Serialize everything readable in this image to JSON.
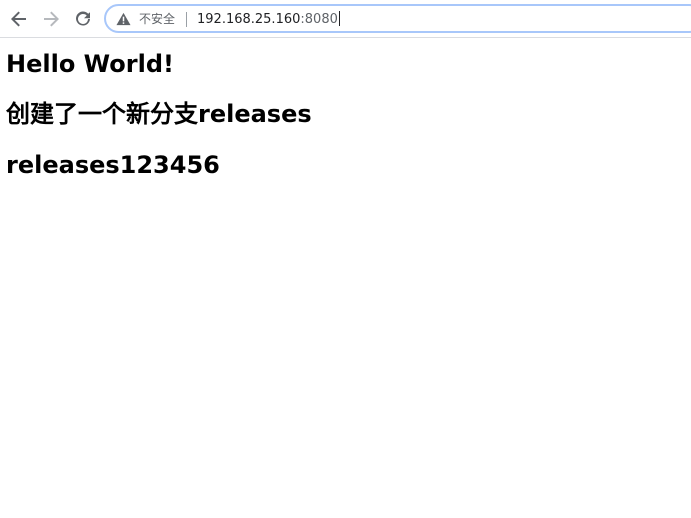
{
  "toolbar": {
    "security_label": "不安全",
    "url_host": "192.168.25.160",
    "url_port": ":8080"
  },
  "icons": {
    "back": "back-arrow-icon",
    "forward": "forward-arrow-icon",
    "reload": "reload-icon",
    "security": "warning-triangle-icon"
  },
  "colors": {
    "omnibox_border": "#a8c7fa",
    "text": "#000000",
    "muted": "#5f6368"
  },
  "page": {
    "headings": [
      "Hello World!",
      "创建了一个新分支releases",
      "releases123456"
    ]
  }
}
